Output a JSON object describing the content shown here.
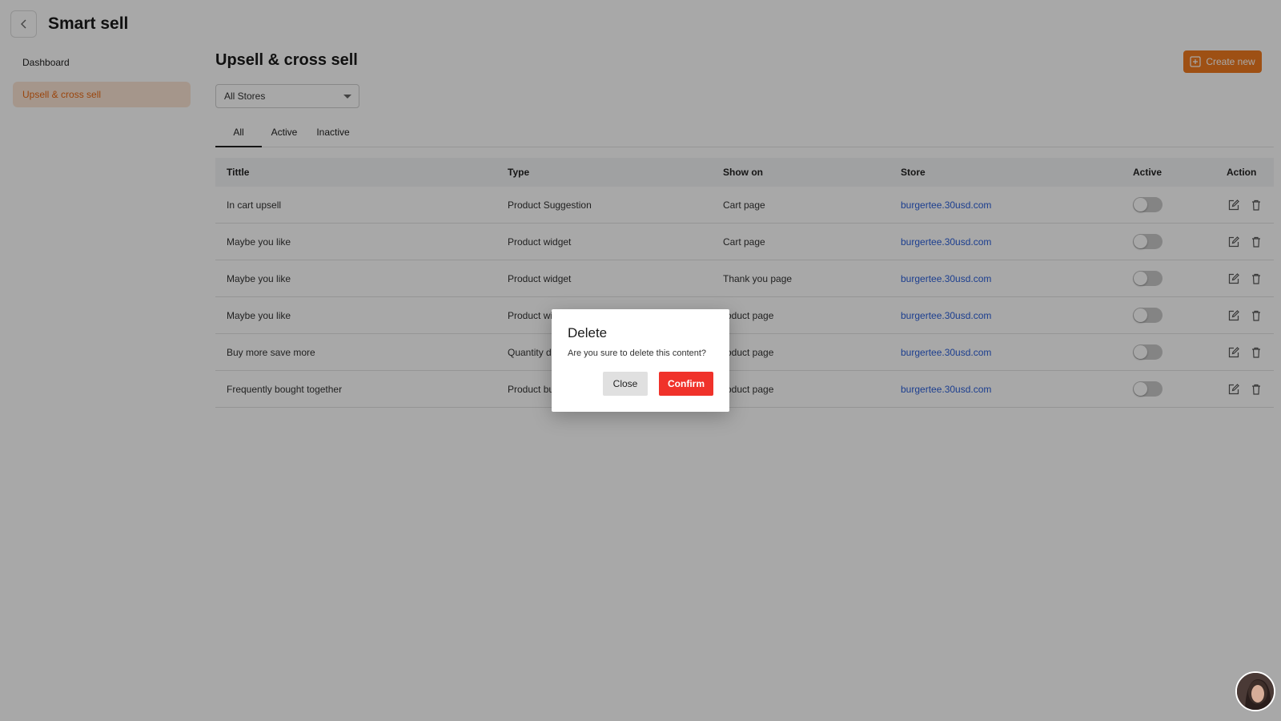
{
  "header": {
    "title": "Smart sell"
  },
  "sidebar": {
    "items": [
      {
        "label": "Dashboard"
      },
      {
        "label": "Upsell & cross sell"
      }
    ]
  },
  "main": {
    "title": "Upsell & cross sell",
    "create_label": "Create new",
    "store_select": {
      "value": "All Stores"
    },
    "tabs": [
      {
        "label": "All"
      },
      {
        "label": "Active"
      },
      {
        "label": "Inactive"
      }
    ]
  },
  "table": {
    "columns": [
      "Tittle",
      "Type",
      "Show on",
      "Store",
      "Active",
      "Action"
    ],
    "rows": [
      {
        "title": "In cart upsell",
        "type": "Product Suggestion",
        "show_on": "Cart page",
        "store": "burgertee.30usd.com"
      },
      {
        "title": "Maybe you like",
        "type": "Product widget",
        "show_on": "Cart page",
        "store": "burgertee.30usd.com"
      },
      {
        "title": "Maybe you like",
        "type": "Product widget",
        "show_on": "Thank you page",
        "store": "burgertee.30usd.com"
      },
      {
        "title": "Maybe you like",
        "type": "Product wi",
        "show_on": "roduct page",
        "store": "burgertee.30usd.com"
      },
      {
        "title": "Buy more save more",
        "type": "Quantity di",
        "show_on": "roduct page",
        "store": "burgertee.30usd.com"
      },
      {
        "title": "Frequently bought together",
        "type": "Product bu",
        "show_on": "roduct page",
        "store": "burgertee.30usd.com"
      }
    ]
  },
  "dialog": {
    "title": "Delete",
    "message": "Are you sure to delete this content?",
    "close_label": "Close",
    "confirm_label": "Confirm"
  },
  "colors": {
    "accent": "#f07a1f",
    "danger": "#f0322a",
    "link": "#2b5fd9"
  },
  "icons": {
    "back": "chevron-left-icon",
    "create": "plus-square-icon",
    "edit": "edit-icon",
    "delete": "trash-icon"
  }
}
